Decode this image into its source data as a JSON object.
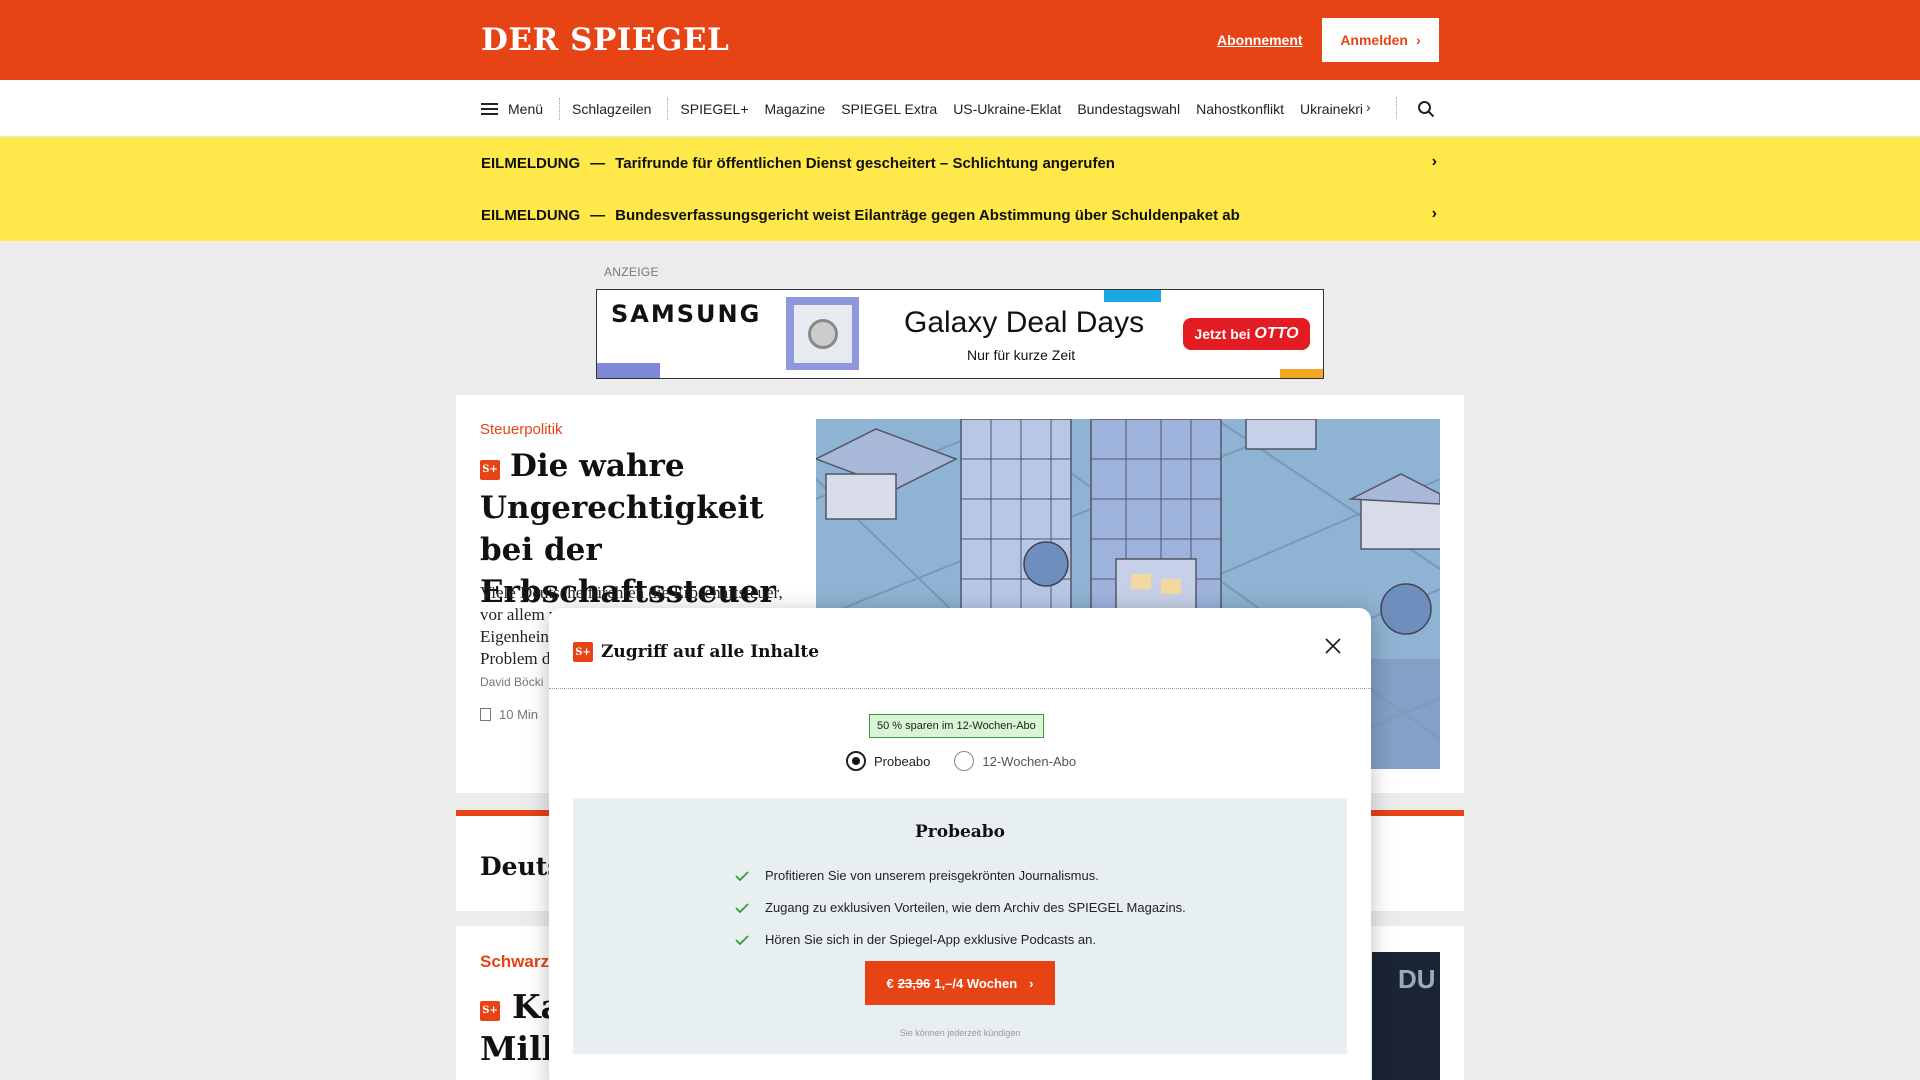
{
  "header": {
    "logo": "DER SPIEGEL",
    "subscription_link": "Abonnement",
    "login_button": "Anmelden",
    "brand_color": "#e64415"
  },
  "nav": {
    "menu_label": "Menü",
    "items": [
      "Schlagzeilen",
      "SPIEGEL+",
      "Magazine",
      "SPIEGEL Extra",
      "US-Ukraine-Eklat",
      "Bundestagswahl",
      "Nahostkonflikt",
      "Ukrainekrieg"
    ],
    "icons": [
      "hamburger-icon",
      "chevron-right-icon",
      "search-icon"
    ]
  },
  "breaking": [
    {
      "label": "EILMELDUNG",
      "dash": "—",
      "text": "Tarifrunde für öffentlichen Dienst gescheitert – Schlichtung angerufen"
    },
    {
      "label": "EILMELDUNG",
      "dash": "—",
      "text": "Bundesverfassungsgericht weist Eilanträge gegen Abstimmung über Schuldenpaket ab"
    }
  ],
  "ad": {
    "label": "ANZEIGE",
    "brand": "SAMSUNG",
    "title": "Galaxy Deal Days",
    "subtitle": "Nur für kurze Zeit",
    "cta_prefix": "Jetzt bei",
    "cta_brand": "OTTO"
  },
  "article": {
    "kicker": "Steuerpolitik",
    "badge": "S+",
    "headline": "Die wahre Ungerechtigkeit bei der Erbschaftssteuer",
    "teaser_lines": [
      "Viele Deutsche fürchten die Erbschaftsteuer,",
      "vor allem w",
      "Eigenhein",
      "Problem d"
    ],
    "author": "David Böcki",
    "read_time": "10 Min"
  },
  "card2": {
    "title": "Deutsc"
  },
  "card3": {
    "kicker": "Schwarz",
    "badge": "S+",
    "title_line1": "Ka",
    "title_line2": "Milli",
    "image_text": "DU"
  },
  "modal": {
    "badge": "S+",
    "title": "Zugriff auf alle Inhalte",
    "save_badge": "50 % sparen im 12-Wochen-Abo",
    "options": [
      {
        "label": "Probeabo",
        "selected": true
      },
      {
        "label": "12-Wochen-Abo",
        "selected": false
      }
    ],
    "plan": {
      "title": "Probeabo",
      "benefits": [
        "Profitieren Sie von unserem preisgekrönten Journalismus.",
        "Zugang zu exklusiven Vorteilen, wie dem Archiv des SPIEGEL Magazins.",
        "Hören Sie sich in der Spiegel-App exklusive Podcasts an."
      ],
      "cta_currency": "€",
      "cta_old_price": "23,96",
      "cta_price": "1,–/4 Wochen",
      "cancel_note": "Sie können jederzeit kündigen"
    }
  },
  "colors": {
    "breaking_bg": "#ffe94a",
    "success": "#3c9b3a",
    "page_bg": "#ececec"
  }
}
